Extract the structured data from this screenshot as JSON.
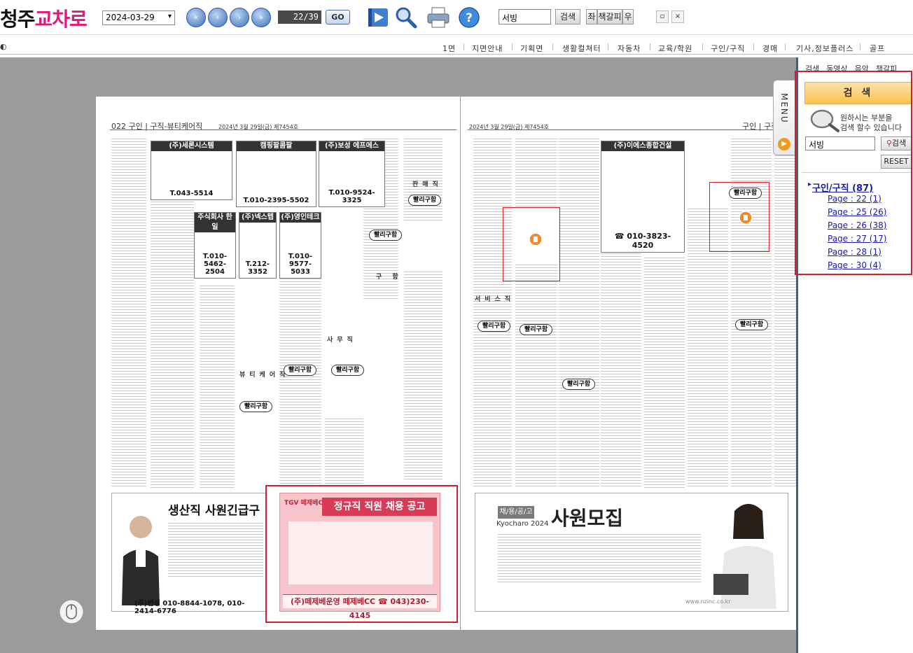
{
  "app": {
    "logo_part1": "청주",
    "logo_part2": "교차로"
  },
  "toolbar": {
    "date_value": "2024-03-29",
    "date_caret": "▾",
    "page_indicator": "22/39",
    "go_label": "GO",
    "search_value": "서빙",
    "search_label": "검색",
    "left_label": "좌",
    "fold_label": "책갈피",
    "right_label": "우",
    "nav_first": "«",
    "nav_prev": "‹",
    "nav_next": "›",
    "nav_last": "»",
    "win_restore": "▫",
    "win_close": "×"
  },
  "menubar": {
    "lead": "◐",
    "items": [
      "1면",
      "지면안내",
      "기획면",
      "생활컬쳐터",
      "자동차",
      "교육/학원",
      "구인/구직",
      "경매",
      "기사,정보플러스",
      "골프"
    ]
  },
  "newspaper": {
    "left_page_label": "022 구인 | 구직-뷰티케어직",
    "left_date": "2024년 3월 29일(금) 제7454호",
    "right_page_label": "구인 | 구직",
    "right_date": "2024년 3월 29일(금) 제7454호",
    "ads_left": [
      {
        "title": "(주)세론시스템",
        "phone": "T.043-5514"
      },
      {
        "title": "캠핑팔콤팔",
        "phone": "T.010-2395-5502"
      },
      {
        "title": "(주)보성 에프에스",
        "phone": "T.010-9524-3325"
      },
      {
        "title": "주식회사 한일",
        "phone": "T.010-5462-2504"
      },
      {
        "title": "(주)넥스텝",
        "phone": "T.212-3352"
      },
      {
        "title": "(주)영인테크",
        "phone": "T.010-9577-5033"
      }
    ],
    "section_labels": [
      "판매직",
      "서비스직",
      "사무직",
      "뷰티케어직",
      "구 함"
    ],
    "tag_label": "빨리구함",
    "bottom_ad_left": {
      "headline": "생산직 사원긴급구",
      "phone": "(주)번성 010-8844-1078, 010-2414-6776"
    },
    "bottom_ad_mid": {
      "company": "TGV 떼제베CC",
      "headline": "정규직 직원 채용 공고",
      "phone": "(주)떼제베운영 떼제베CC ☎ 043)230-4145"
    },
    "bottom_ad_right": {
      "sub": "채/용/공/고",
      "headline": "사원모집",
      "brand": "Kyocharo 2024",
      "url": "www.nzinc.co.kr"
    },
    "right_ads": [
      {
        "title": "(주)이에스종합건설",
        "phone": "☎ 010-3823-4520"
      }
    ]
  },
  "right_panel": {
    "tabs": [
      "검색",
      "동영상",
      "음악",
      "책갈피"
    ],
    "header": "검 색",
    "desc_line1": "원하시는 부분을",
    "desc_line2": "검색 할수 있습니다",
    "search_value": "서빙",
    "search_btn": "검색",
    "reset_btn": "RESET",
    "result_category": "구인/구직 (87)",
    "result_pages": [
      "Page : 22 (1)",
      "Page : 25 (26)",
      "Page : 26 (38)",
      "Page : 27 (17)",
      "Page : 28 (1)",
      "Page : 30 (4)"
    ]
  },
  "menu_tab": {
    "label": "MENU",
    "dot": "▶"
  },
  "colors": {
    "accent_pink": "#e0197a",
    "highlight_red": "#d21f2a",
    "link_blue": "#1a1aa6",
    "panel_border": "#3e5f8d"
  }
}
